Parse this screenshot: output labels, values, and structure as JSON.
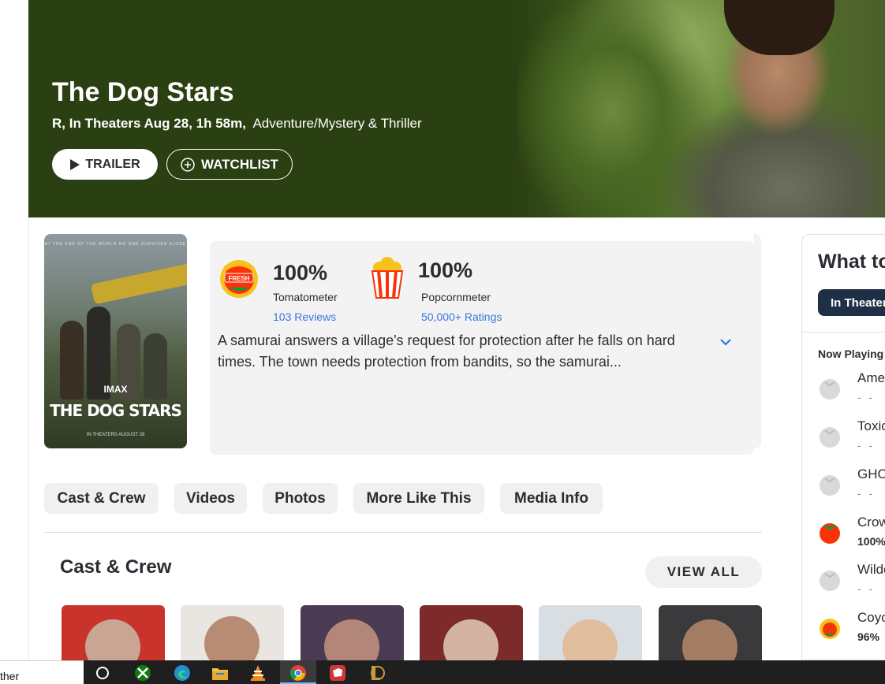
{
  "hero": {
    "title": "The Dog Stars",
    "meta_bold": "R, In Theaters Aug 28, 1h 58m,",
    "genre": "Adventure/Mystery & Thriller",
    "trailer_label": "TRAILER",
    "watchlist_label": "WATCHLIST"
  },
  "poster": {
    "tagline": "AT THE END OF THE WORLD NO ONE SURVIVES ALONE",
    "imax": "IMAX",
    "title": "THE DOG STARS",
    "release": "IN THEATERS AUGUST 28"
  },
  "scores": {
    "tomatometer": {
      "badge": "FRESH",
      "value": "100%",
      "label": "Tomatometer",
      "link": "103 Reviews"
    },
    "popcornmeter": {
      "value": "100%",
      "label": "Popcornmeter",
      "link": "50,000+ Ratings"
    },
    "synopsis": "A samurai answers a village's request for protection after he falls on hard times. The town needs protection from bandits, so the samurai..."
  },
  "tabs": [
    "Cast & Crew",
    "Videos",
    "Photos",
    "More Like This",
    "Media Info"
  ],
  "cast_section": {
    "title": "Cast & Crew",
    "view_all_label": "VIEW ALL"
  },
  "rail": {
    "title": "What to",
    "tab": "In Theaters",
    "subtitle": "Now Playing",
    "items": [
      {
        "name": "Ame",
        "score": "- -",
        "icon": "empty-tomato-icon"
      },
      {
        "name": "Toxic",
        "score": "- -",
        "icon": "empty-tomato-icon"
      },
      {
        "name": "GHO",
        "score": "- -",
        "icon": "empty-tomato-icon"
      },
      {
        "name": "Crow",
        "score": "100%",
        "icon": "fresh-tomato-icon"
      },
      {
        "name": "Wilde",
        "score": "- -",
        "icon": "empty-tomato-icon"
      },
      {
        "name": "Coyo",
        "score": "96%",
        "icon": "certified-fresh-icon"
      }
    ]
  },
  "taskbar": {
    "weather_text": "ther",
    "icons": [
      "search-circle-icon",
      "xbox-icon",
      "edge-icon",
      "file-explorer-icon",
      "vlc-icon",
      "chrome-icon",
      "riot-icon",
      "league-icon"
    ]
  },
  "colors": {
    "hero_bg": "#2b4012",
    "panel_bg": "#f3f3f3",
    "link": "#3976dc",
    "rail_tab": "#1f3046",
    "fresh_red": "#fa320a"
  }
}
